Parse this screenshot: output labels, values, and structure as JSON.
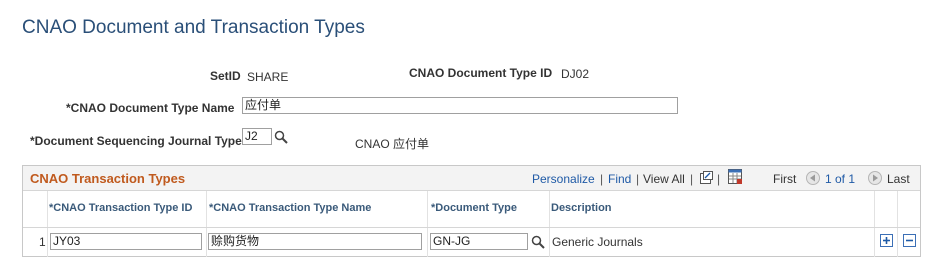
{
  "page_title": "CNAO Document and Transaction Types",
  "setid": {
    "label": "SetID",
    "value": "SHARE"
  },
  "doc_type_id": {
    "label": "CNAO Document Type ID",
    "value": "DJ02"
  },
  "doc_type_name": {
    "label": "*CNAO Document Type Name",
    "value": "应付单"
  },
  "seq_journal_type": {
    "label": "*Document Sequencing Journal Type",
    "value": "J2",
    "description": "CNAO 应付单"
  },
  "grid": {
    "title": "CNAO Transaction Types",
    "personalize": "Personalize",
    "separator": "|",
    "find": "Find",
    "view_all": "View All",
    "first": "First",
    "range": "1 of 1",
    "last": "Last",
    "columns": {
      "trans_id": "*CNAO Transaction Type ID",
      "trans_name": "*CNAO Transaction Type Name",
      "doc_type": "*Document Type",
      "description": "Description"
    },
    "rows": [
      {
        "num": "1",
        "trans_id": "JY03",
        "trans_name": "赊购货物",
        "doc_type": "GN-JG",
        "description": "Generic Journals"
      }
    ]
  }
}
